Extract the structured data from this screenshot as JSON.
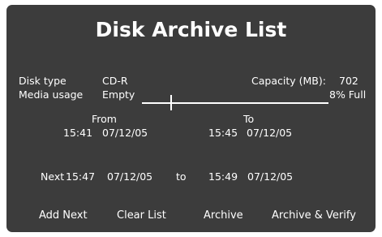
{
  "title": "Disk Archive List",
  "disk": {
    "type_label": "Disk type",
    "type_value": "CD-R",
    "capacity_label": "Capacity (MB):",
    "capacity_value": "702",
    "usage_label": "Media usage",
    "usage_value": "Empty",
    "usage_full": "8% Full",
    "usage_fraction": 0.08
  },
  "range": {
    "from_label": "From",
    "from_time": "15:41",
    "from_date": "07/12/05",
    "to_label": "To",
    "to_time": "15:45",
    "to_date": "07/12/05"
  },
  "next": {
    "label": "Next",
    "start_time": "15:47",
    "start_date": "07/12/05",
    "to_word": "to",
    "end_time": "15:49",
    "end_date": "07/12/05"
  },
  "buttons": {
    "add_next": "Add Next",
    "clear_list": "Clear List",
    "archive": "Archive",
    "archive_verify": "Archive & Verify"
  },
  "colors": {
    "panel": "#3c3c3c",
    "text": "#ffffff"
  }
}
